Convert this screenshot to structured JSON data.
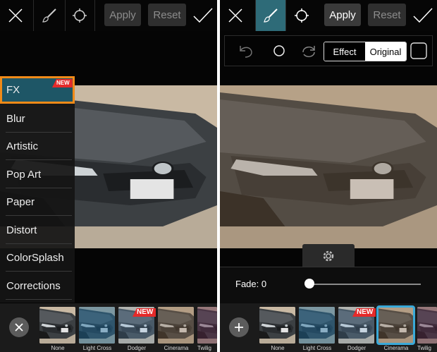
{
  "left": {
    "toolbar": {
      "apply_label": "Apply",
      "reset_label": "Reset"
    },
    "menu": [
      {
        "label": "FX",
        "badge": "NEW"
      },
      {
        "label": "Blur"
      },
      {
        "label": "Artistic"
      },
      {
        "label": "Pop Art"
      },
      {
        "label": "Paper"
      },
      {
        "label": "Distort"
      },
      {
        "label": "ColorSplash"
      },
      {
        "label": "Corrections"
      }
    ],
    "effects": [
      {
        "label": "None"
      },
      {
        "label": "Light Cross"
      },
      {
        "label": "Dodger",
        "badge": "NEW"
      },
      {
        "label": "Cinerama"
      },
      {
        "label": "Twilig"
      }
    ]
  },
  "right": {
    "toolbar": {
      "apply_label": "Apply",
      "reset_label": "Reset"
    },
    "controls": {
      "effect_label": "Effect",
      "original_label": "Original",
      "selected": "Original"
    },
    "fade": {
      "label": "Fade: 0",
      "value": 0
    },
    "effects": [
      {
        "label": "None"
      },
      {
        "label": "Light Cross"
      },
      {
        "label": "Dodger",
        "badge": "NEW"
      },
      {
        "label": "Cinerama",
        "selected": true
      },
      {
        "label": "Twilig"
      }
    ]
  },
  "colors": {
    "accent": "#2e6b78",
    "highlight": "#f08a18",
    "badge": "#e52a2a",
    "selection": "#3aa9d8"
  },
  "icons": [
    "close-icon",
    "brush-icon",
    "selection-icon",
    "checkmark-icon",
    "undo-icon",
    "circle-icon",
    "redo-icon",
    "square-icon",
    "gear-icon",
    "plus-icon"
  ]
}
